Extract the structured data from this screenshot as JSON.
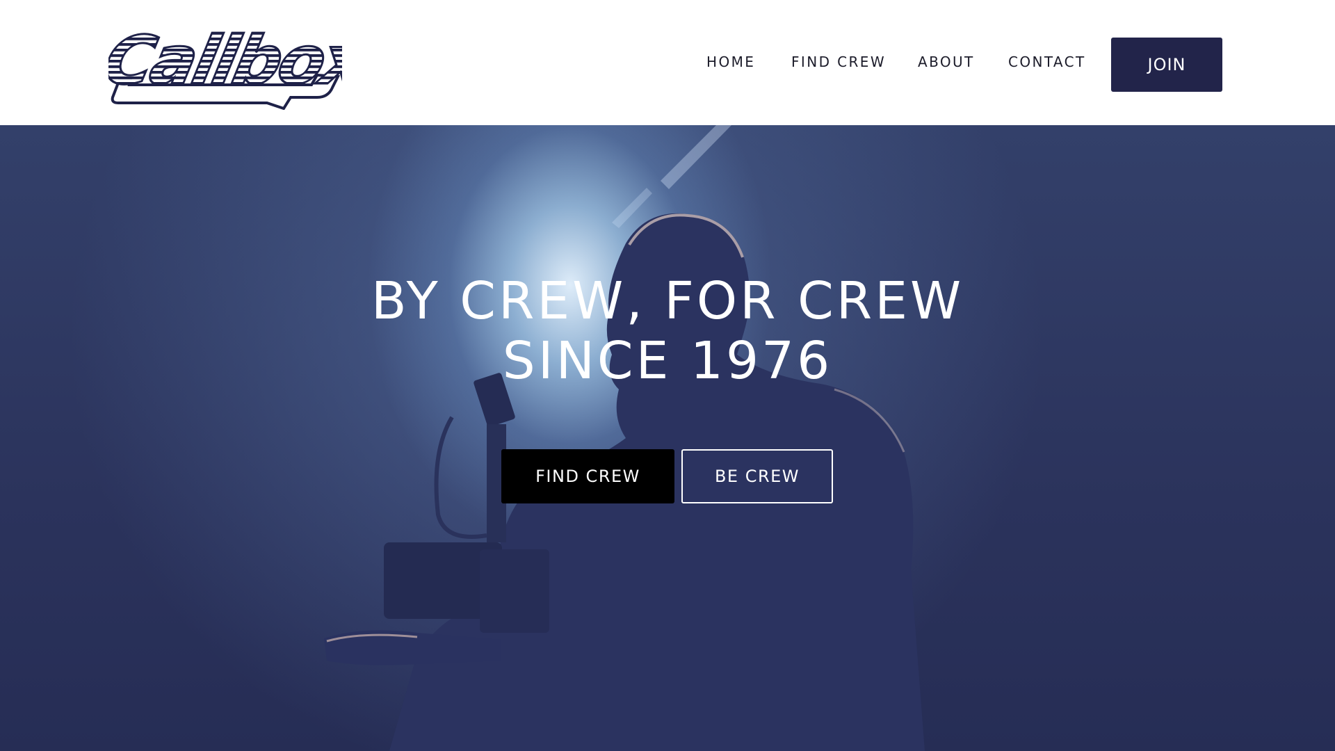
{
  "brand": {
    "logo_text": "Callbox",
    "logo_color": "#1e2148"
  },
  "nav": {
    "items": [
      {
        "label": "HOME"
      },
      {
        "label": "FIND CREW"
      },
      {
        "label": "ABOUT"
      },
      {
        "label": "CONTACT"
      }
    ],
    "join_label": "JOIN"
  },
  "hero": {
    "headline_line1": "BY CREW, FOR CREW",
    "headline_line2": "SINCE 1976",
    "primary_button": "FIND CREW",
    "secondary_button": "BE CREW",
    "overlay_color": "#2a3259"
  },
  "colors": {
    "accent": "#22244a",
    "header_bg": "#ffffff",
    "nav_text": "#1c1c2a"
  }
}
